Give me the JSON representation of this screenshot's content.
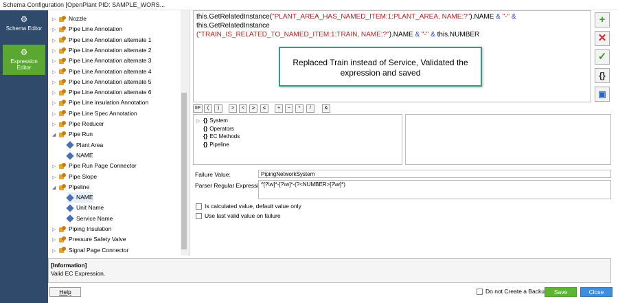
{
  "window": {
    "title": "Schema Configuration [OpenPlant PID: SAMPLE_WORS..."
  },
  "nav": {
    "schema_editor": "Schema Editor",
    "expression_editor": "Expression Editor"
  },
  "tree": {
    "items": [
      {
        "label": "Nozzle",
        "type": "folder",
        "expander": "▷"
      },
      {
        "label": "Pipe Line Annotation",
        "type": "folder",
        "expander": "▷"
      },
      {
        "label": "Pipe Line Annotation alternate 1",
        "type": "folder",
        "expander": "▷"
      },
      {
        "label": "Pipe Line Annotation alternate 2",
        "type": "folder",
        "expander": "▷"
      },
      {
        "label": "Pipe Line Annotation alternate 3",
        "type": "folder",
        "expander": "▷"
      },
      {
        "label": "Pipe Line Annotation alternate 4",
        "type": "folder",
        "expander": "▷"
      },
      {
        "label": "Pipe Line Annotation alternate 5",
        "type": "folder",
        "expander": "▷"
      },
      {
        "label": "Pipe Line Annotation alternate 6",
        "type": "folder",
        "expander": "▷"
      },
      {
        "label": "Pipe Line insulation Annotation",
        "type": "folder",
        "expander": "▷"
      },
      {
        "label": "Pipe Line Spec Annotation",
        "type": "folder",
        "expander": "▷"
      },
      {
        "label": "Pipe Reducer",
        "type": "folder",
        "expander": "▷"
      },
      {
        "label": "Pipe Run",
        "type": "folder",
        "expander": "◢"
      },
      {
        "label": "Plant Area",
        "type": "prop",
        "indent": true
      },
      {
        "label": "NAME",
        "type": "prop",
        "indent": true
      },
      {
        "label": "Pipe Run Page Connector",
        "type": "folder",
        "expander": "▷"
      },
      {
        "label": "Pipe Slope",
        "type": "folder",
        "expander": "▷"
      },
      {
        "label": "Pipeline",
        "type": "folder",
        "expander": "◢"
      },
      {
        "label": "NAME",
        "type": "prop",
        "indent": true,
        "selected": true
      },
      {
        "label": "Unit Name",
        "type": "prop",
        "indent": true
      },
      {
        "label": "Service Name",
        "type": "prop",
        "indent": true
      },
      {
        "label": "Piping Insulation",
        "type": "folder",
        "expander": "▷"
      },
      {
        "label": "Pressure Safety Valve",
        "type": "folder",
        "expander": "▷"
      },
      {
        "label": "Signal Page Connector",
        "type": "folder",
        "expander": "▷"
      }
    ]
  },
  "expression": {
    "p1": "this.GetRelatedInstance(",
    "s1": "\"PLANT_AREA_HAS_NAMED_ITEM:1:PLANT_AREA, NAME:?\"",
    "p2": ").NAME ",
    "o1": "&",
    "s2": " \"-\" ",
    "o2": "&",
    "p3": " this.GetRelatedInstance",
    "s3": "(\"TRAIN_IS_RELATED_TO_NAMED_ITEM:1:TRAIN, NAME:?\"",
    "p4": ").NAME ",
    "o3": "&",
    "s4": " \"-\" ",
    "o4": "&",
    "p5": " this.NUMBER"
  },
  "callout": {
    "text": "Replaced Train instead of Service, Validated the expression and saved"
  },
  "operators": [
    "IIF",
    "(",
    ")",
    ">",
    "<",
    "≥",
    "≤",
    "+",
    "−",
    "*",
    "/",
    "&"
  ],
  "functions": [
    {
      "label": "System"
    },
    {
      "label": "Operators"
    },
    {
      "label": "EC Methods"
    },
    {
      "label": "Pipeline"
    }
  ],
  "failure": {
    "label": "Failure Value:",
    "value": "PipingNetworkSystem"
  },
  "parser": {
    "label": "Parser Regular Expression:",
    "value": "^[?\\w]*-[?\\w]*-(?<NUMBER>[?\\w]*)"
  },
  "options": {
    "calculated": "Is calculated value, default value only",
    "last_valid": "Use last valid value on failure"
  },
  "info": {
    "title": "[Information]",
    "message": "Valid EC Expression."
  },
  "footer": {
    "help": "Help",
    "backup": "Do not Create a Backup",
    "save": "Save",
    "close": "Close"
  },
  "colors": {
    "nav_bg": "#2f4a6b",
    "nav_active": "#5aa832",
    "callout_border": "#27a383",
    "save_bg": "#5cb531",
    "close_bg": "#3b8ee0"
  }
}
